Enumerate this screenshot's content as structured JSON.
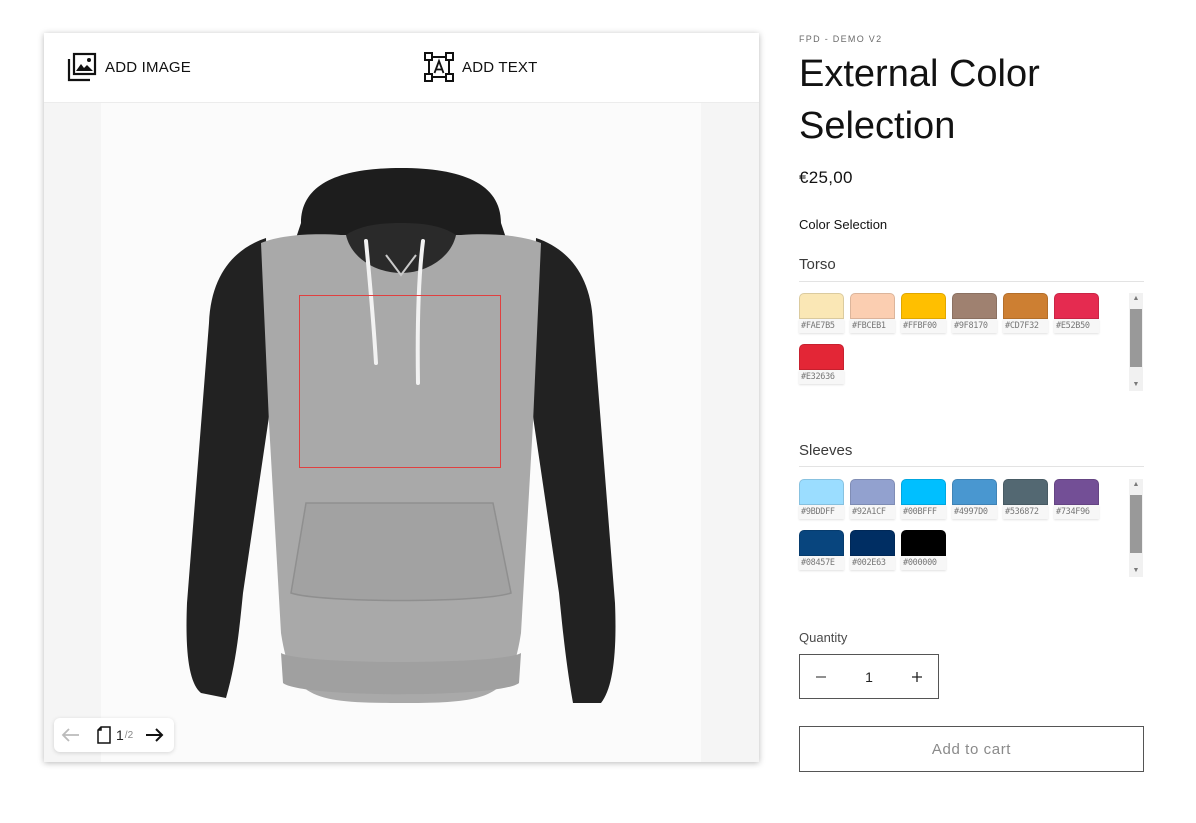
{
  "designer": {
    "add_image_label": "ADD IMAGE",
    "add_text_label": "ADD TEXT",
    "pager": {
      "current": "1",
      "total": "/2"
    }
  },
  "product": {
    "vendor": "FPD - DEMO V2",
    "title": "External Color Selection",
    "price": "€25,00",
    "color_selection_label": "Color Selection",
    "groups": [
      {
        "name": "Torso",
        "swatches": [
          "#FAE7B5",
          "#FBCEB1",
          "#FFBF00",
          "#9F8170",
          "#CD7F32",
          "#E52B50",
          "#E32636"
        ]
      },
      {
        "name": "Sleeves",
        "swatches": [
          "#9BDDFF",
          "#92A1CF",
          "#00BFFF",
          "#4997D0",
          "#536872",
          "#734F96",
          "#08457E",
          "#002E63",
          "#000000"
        ]
      }
    ],
    "quantity_label": "Quantity",
    "quantity_value": "1",
    "add_to_cart_label": "Add to cart"
  }
}
